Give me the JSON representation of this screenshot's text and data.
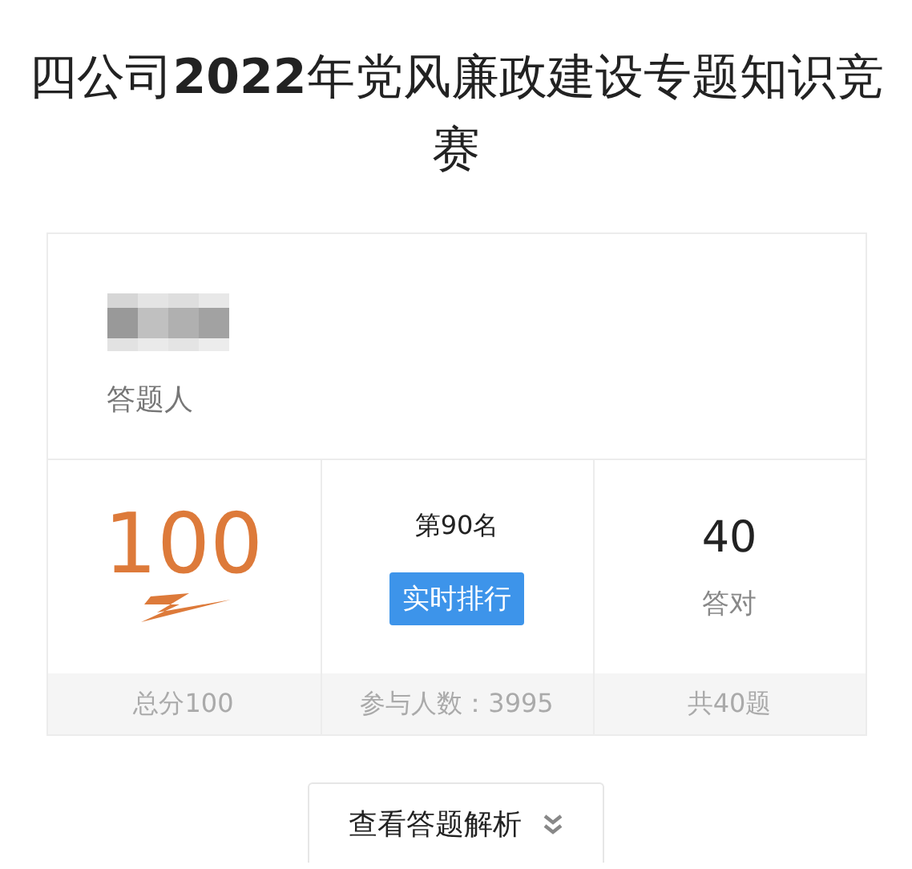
{
  "title": "四公司**2022**年党风廉政建设专题知识竞赛",
  "participant": {
    "label": "答题人"
  },
  "stats": [
    {
      "kind": "score",
      "value": "100",
      "footer": "总分100"
    },
    {
      "kind": "rank",
      "value": "第90名",
      "button": "实时排行",
      "footer": "参与人数：3995"
    },
    {
      "kind": "correct",
      "value": "40",
      "caption": "答对",
      "footer": "共40题"
    }
  ],
  "review_button": {
    "label": "查看答题解析"
  }
}
